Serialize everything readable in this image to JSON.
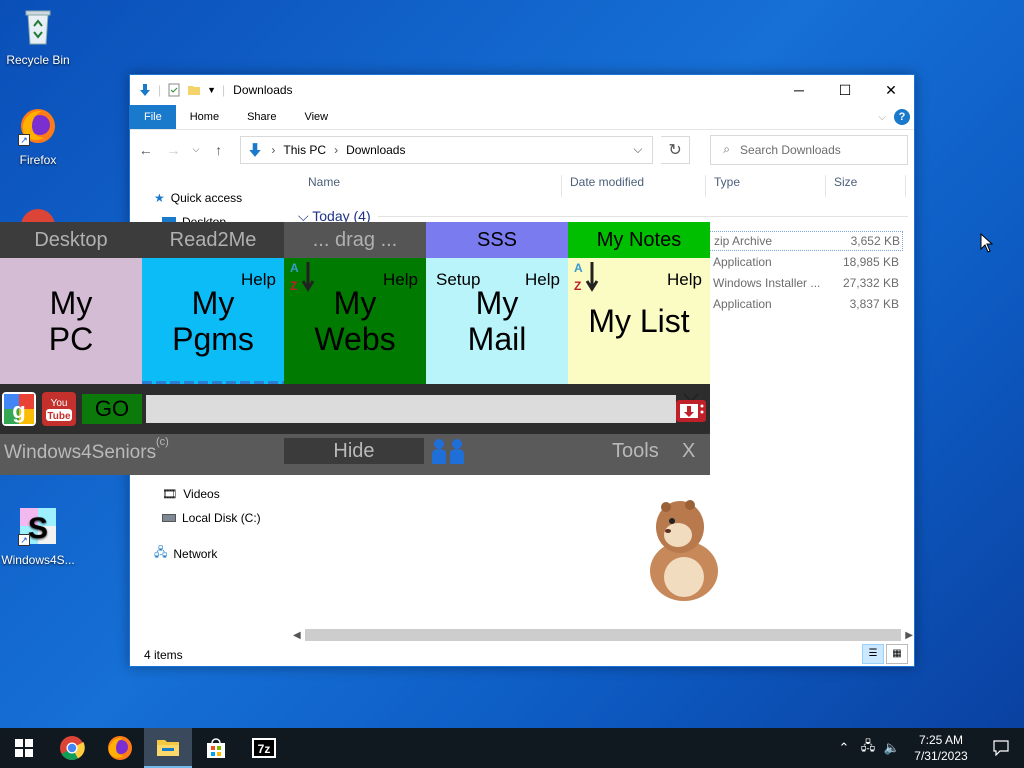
{
  "desktop": {
    "icons": [
      {
        "label": "Recycle Bin"
      },
      {
        "label": "Firefox"
      },
      {
        "label": "Windows4S..."
      }
    ]
  },
  "explorer": {
    "title": "Downloads",
    "ribbon_tabs": [
      "File",
      "Home",
      "Share",
      "View"
    ],
    "breadcrumb": [
      "This PC",
      "Downloads"
    ],
    "search_placeholder": "Search Downloads",
    "columns": [
      "Name",
      "Date modified",
      "Type",
      "Size"
    ],
    "group_label": "Today (4)",
    "nav": {
      "quick_access": "Quick access",
      "desktop": "Desktop",
      "videos": "Videos",
      "local_disk": "Local Disk (C:)",
      "network": "Network"
    },
    "files": [
      {
        "type": "zip Archive",
        "size": "3,652 KB"
      },
      {
        "type": "Application",
        "size": "18,985 KB"
      },
      {
        "type": "Windows Installer ...",
        "size": "27,332 KB"
      },
      {
        "type": "Application",
        "size": "3,837 KB"
      }
    ],
    "status": "4 items"
  },
  "w4s": {
    "top_tabs": [
      {
        "label": "Desktop",
        "bg": "#3c3c3c",
        "color": "#b0b0b0"
      },
      {
        "label": "Read2Me",
        "bg": "#3c3c3c",
        "color": "#b0b0b0"
      },
      {
        "label": "... drag ...",
        "bg": "#555555",
        "color": "#b0b0b0"
      },
      {
        "label": "SSS",
        "bg": "#7b7bf0",
        "color": "#000000"
      },
      {
        "label": "My Notes",
        "bg": "#00bf00",
        "color": "#000000"
      }
    ],
    "tiles": [
      {
        "line1": "My",
        "line2": "PC",
        "bg": "#d4bcd4"
      },
      {
        "line1": "My",
        "line2": "Pgms",
        "bg": "#0cbcf7",
        "help": "Help"
      },
      {
        "line1": "My",
        "line2": "Webs",
        "bg": "#007a00",
        "help": "Help"
      },
      {
        "line1": "My",
        "line2": "Mail",
        "bg": "#b9f4fb",
        "help": "Help",
        "setup": "Setup"
      },
      {
        "line1": "My List",
        "line2": "",
        "bg": "#fbfbc4",
        "help": "Help"
      }
    ],
    "go_label": "GO",
    "brand": "Windows4Seniors",
    "brand_mark": "(c)",
    "hide_label": "Hide",
    "tools_label": "Tools",
    "close_label": "X"
  },
  "taskbar": {
    "time": "7:25 AM",
    "date": "7/31/2023",
    "apps": [
      "start-icon",
      "chrome-icon",
      "firefox-icon",
      "file-explorer-icon",
      "store-icon",
      "7zip-icon"
    ]
  }
}
